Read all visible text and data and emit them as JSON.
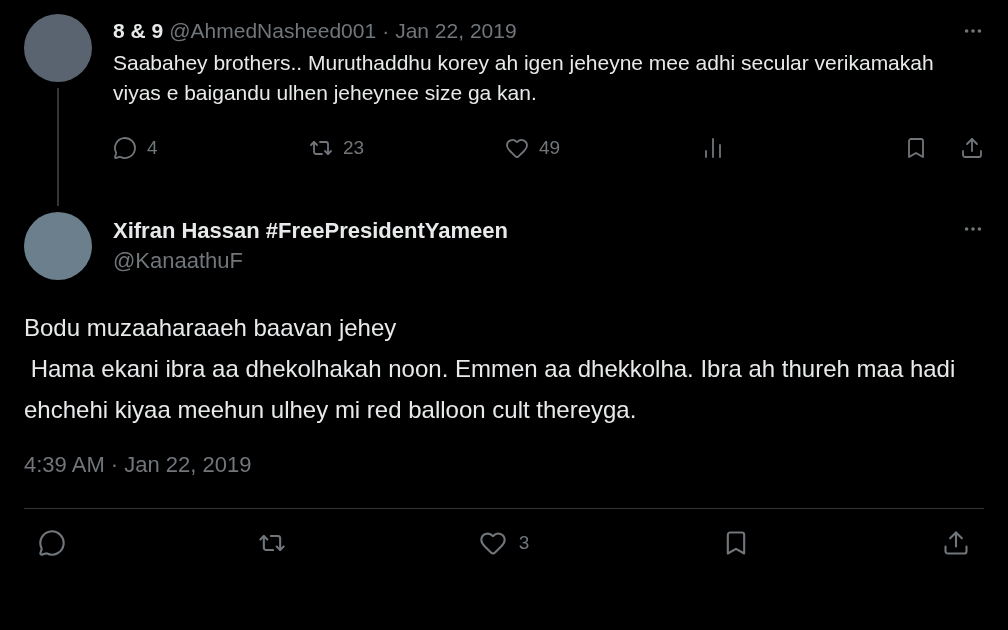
{
  "reply_tweet": {
    "author_name": "8 & 9",
    "handle": "@AhmedNasheed001",
    "separator": "·",
    "date": "Jan 22, 2019",
    "text": "Saabahey brothers.. Muruthaddhu korey ah igen jeheyne mee adhi secular verikamakah viyas e baigandu ulhen jeheynee size ga kan.",
    "actions": [
      {
        "kind": "reply",
        "count": "4"
      },
      {
        "kind": "retweet",
        "count": "23"
      },
      {
        "kind": "like",
        "count": "49"
      },
      {
        "kind": "views"
      },
      {
        "kind": "bookmark"
      },
      {
        "kind": "share"
      }
    ]
  },
  "main_tweet": {
    "author_name": "Xifran Hassan #FreePresidentYameen",
    "handle": "@KanaathuF",
    "text": "Bodu muzaaharaaeh baavan jehey\n Hama ekani ibra aa dhekolhakah noon. Emmen aa dhekkolha. Ibra ah thureh maa hadi ehchehi kiyaa meehun ulhey mi red balloon cult thereyga.",
    "timestamp": "4:39 AM · Jan 22, 2019",
    "actions": [
      {
        "kind": "reply"
      },
      {
        "kind": "retweet"
      },
      {
        "kind": "like",
        "count": "3"
      },
      {
        "kind": "bookmark"
      },
      {
        "kind": "share"
      }
    ]
  }
}
